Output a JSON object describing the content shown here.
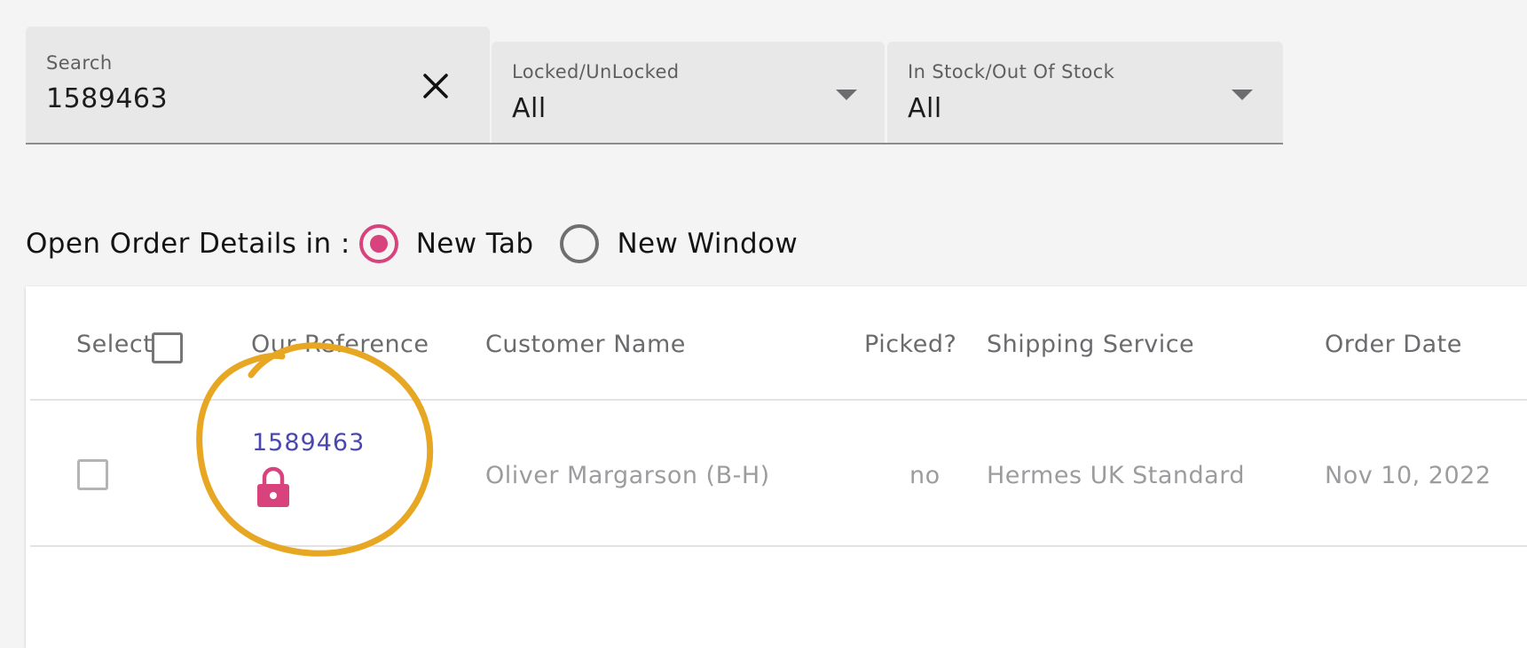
{
  "filters": {
    "search": {
      "label": "Search",
      "value": "1589463",
      "clear_icon": "close-icon"
    },
    "locked": {
      "label": "Locked/UnLocked",
      "value": "All",
      "icon": "chevron-down-icon"
    },
    "stock": {
      "label": "In Stock/Out Of Stock",
      "value": "All",
      "icon": "chevron-down-icon"
    }
  },
  "open_details": {
    "label": "Open Order Details in :",
    "options": [
      {
        "label": "New Tab",
        "checked": true
      },
      {
        "label": "New Window",
        "checked": false
      }
    ]
  },
  "table": {
    "headers": {
      "select": "Select",
      "reference": "Our Reference",
      "customer": "Customer Name",
      "picked": "Picked?",
      "shipping": "Shipping Service",
      "order_date": "Order Date"
    },
    "rows": [
      {
        "reference": "1589463",
        "locked": true,
        "customer": "Oliver Margarson (B-H)",
        "picked": "no",
        "shipping": "Hermes UK Standard",
        "order_date": "Nov 10, 2022"
      }
    ]
  },
  "colors": {
    "accent_pink": "#d8437e",
    "link_blue": "#4a48b0",
    "annotation_orange": "#e7a723"
  },
  "annotation": {
    "shape": "hand-drawn circle",
    "target": "row-reference-cell"
  }
}
